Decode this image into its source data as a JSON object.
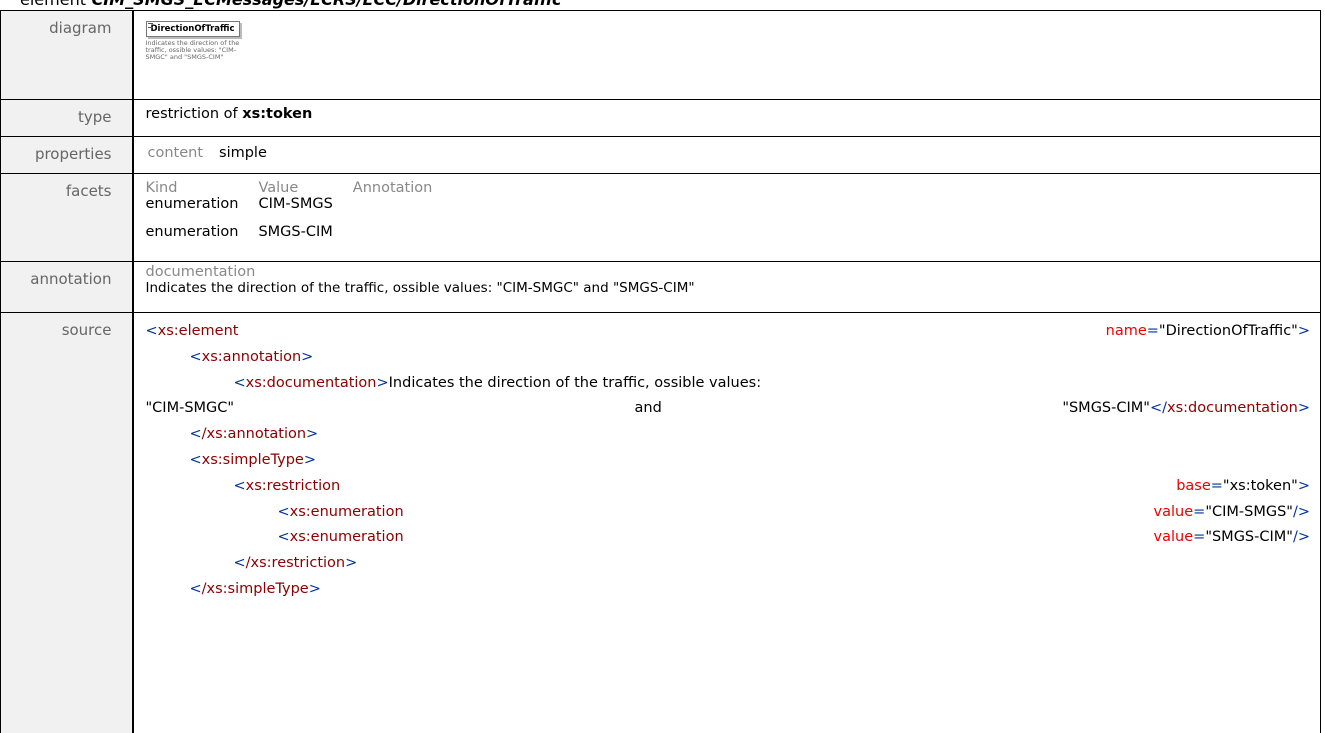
{
  "heading": {
    "prefix": "element",
    "path": "CIM_SMGS_ECMessages/ECRS/ECC/DirectionOfTraffic"
  },
  "labels": {
    "diagram": "diagram",
    "type": "type",
    "properties": "properties",
    "facets": "facets",
    "annotation": "annotation",
    "source": "source"
  },
  "diagram": {
    "box_label": "DirectionOfTraffic",
    "description": "Indicates the direction of the traffic, ossible values: \"CIM-SMGC\" and \"SMGS-CIM\""
  },
  "type": {
    "prefix": "restriction of",
    "base": "xs:token"
  },
  "properties": {
    "key": "content",
    "value": "simple"
  },
  "facets": {
    "headers": {
      "kind": "Kind",
      "value": "Value",
      "annotation": "Annotation"
    },
    "rows": [
      {
        "kind": "enumeration",
        "value": "CIM-SMGS"
      },
      {
        "kind": "enumeration",
        "value": "SMGS-CIM"
      }
    ]
  },
  "annotation": {
    "key": "documentation",
    "text": "Indicates the direction of the traffic, ossible values: \"CIM-SMGC\" and \"SMGS-CIM\""
  },
  "source": {
    "l1": {
      "tag": "xs:element",
      "attr": "name",
      "val": "\"DirectionOfTraffic\""
    },
    "l2": {
      "tag": "xs:annotation"
    },
    "l3": {
      "tag": "xs:documentation",
      "text": "Indicates the direction of the traffic, ossible values:"
    },
    "l4": {
      "a": "\"CIM-SMGC\"",
      "b": "and",
      "c": "\"SMGS-CIM\"",
      "close": "xs:documentation"
    },
    "l5": {
      "tag": "/xs:annotation"
    },
    "l6": {
      "tag": "xs:simpleType"
    },
    "l7": {
      "tag": "xs:restriction",
      "attr": "base",
      "val": "\"xs:token\""
    },
    "l8": {
      "tag": "xs:enumeration",
      "attr": "value",
      "val": "\"CIM-SMGS\""
    },
    "l9": {
      "tag": "xs:enumeration",
      "attr": "value",
      "val": "\"SMGS-CIM\""
    },
    "l10": {
      "tag": "/xs:restriction"
    },
    "l11": {
      "tag": "/xs:simpleType"
    }
  }
}
